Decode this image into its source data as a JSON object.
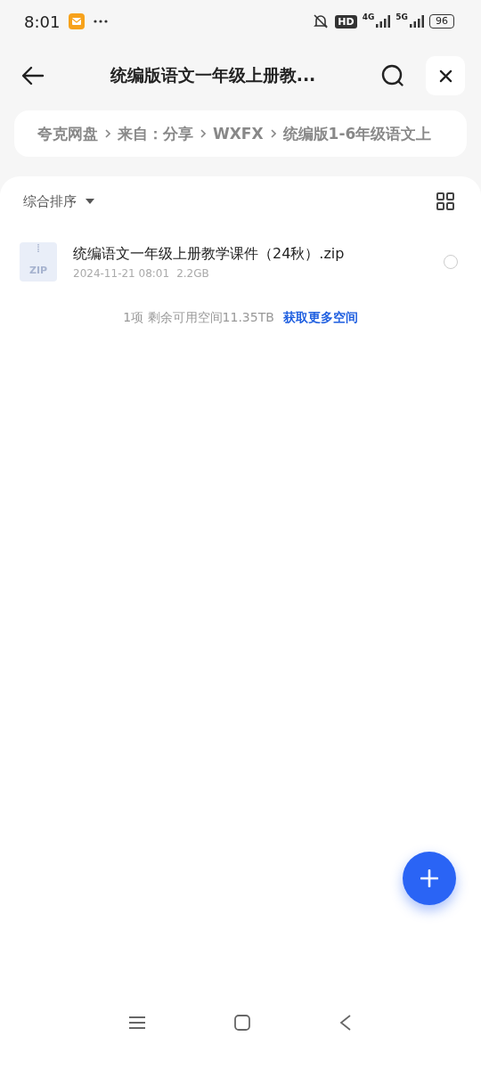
{
  "status_bar": {
    "time": "8:01",
    "hd": "HD",
    "network_1": "4G",
    "network_2": "5G",
    "battery": "96"
  },
  "header": {
    "title": "统编版语文一年级上册教..."
  },
  "breadcrumbs": [
    "夸克网盘",
    "来自：分享",
    "WXFX",
    "统编版1-6年级语文上"
  ],
  "sort": {
    "label": "综合排序"
  },
  "files": [
    {
      "kind": "zip",
      "icon_label": "ZIP",
      "name": "统编语文一年级上册教学课件（24秋）.zip",
      "date": "2024-11-21 08:01",
      "size": "2.2GB",
      "selected": false
    }
  ],
  "footer": {
    "summary": "1项 剩余可用空间11.35TB",
    "link": "获取更多空间"
  }
}
